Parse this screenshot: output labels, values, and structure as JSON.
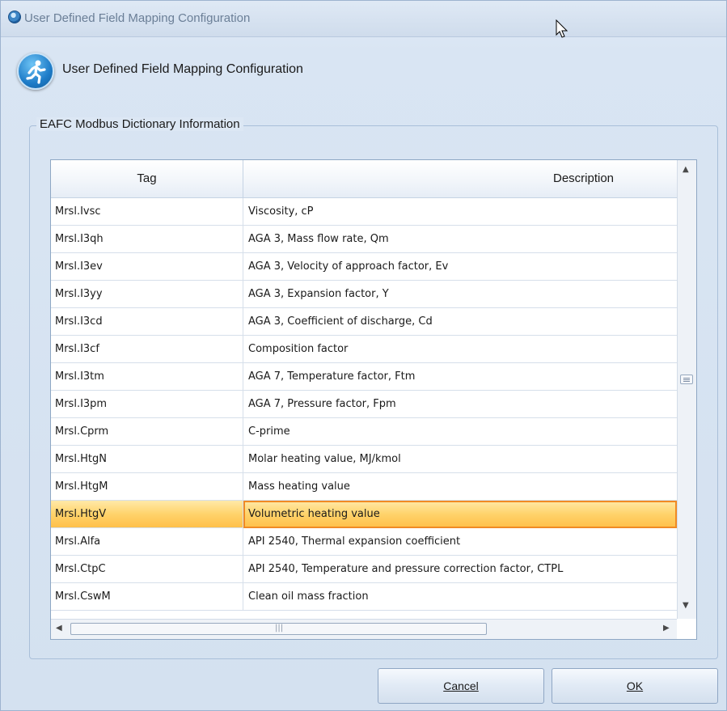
{
  "window": {
    "title": "User Defined Field Mapping Configuration"
  },
  "header": {
    "text": "User Defined Field Mapping Configuration",
    "icon": "running-person-icon"
  },
  "group": {
    "label": "EAFC Modbus Dictionary Information"
  },
  "grid": {
    "columns": [
      "Tag",
      "Description"
    ],
    "rows": [
      {
        "tag": "Mrsl.Ivsc",
        "description": "Viscosity, cP"
      },
      {
        "tag": "Mrsl.I3qh",
        "description": "AGA 3, Mass flow rate, Qm"
      },
      {
        "tag": "Mrsl.I3ev",
        "description": "AGA 3, Velocity of approach factor, Ev"
      },
      {
        "tag": "Mrsl.I3yy",
        "description": "AGA 3, Expansion factor, Y"
      },
      {
        "tag": "Mrsl.I3cd",
        "description": "AGA 3, Coefficient of discharge, Cd"
      },
      {
        "tag": "Mrsl.I3cf",
        "description": "Composition factor"
      },
      {
        "tag": "Mrsl.I3tm",
        "description": "AGA 7, Temperature factor, Ftm"
      },
      {
        "tag": "Mrsl.I3pm",
        "description": "AGA 7, Pressure factor, Fpm"
      },
      {
        "tag": "Mrsl.Cprm",
        "description": "C-prime"
      },
      {
        "tag": "Mrsl.HtgN",
        "description": "Molar heating value, MJ/kmol"
      },
      {
        "tag": "Mrsl.HtgM",
        "description": "Mass heating value"
      },
      {
        "tag": "Mrsl.HtgV",
        "description": "Volumetric heating value",
        "selected": true
      },
      {
        "tag": "Mrsl.Alfa",
        "description": "API 2540, Thermal expansion coefficient"
      },
      {
        "tag": "Mrsl.CtpC",
        "description": "API 2540, Temperature and pressure correction factor, CTPL"
      },
      {
        "tag": "Mrsl.CswM",
        "description": "Clean oil mass fraction"
      }
    ]
  },
  "buttons": {
    "cancel": "Cancel",
    "ok": "OK"
  },
  "colors": {
    "selection": "#ffd36b",
    "selection_border": "#f08a24",
    "window_bg": "#d9e5f3"
  }
}
